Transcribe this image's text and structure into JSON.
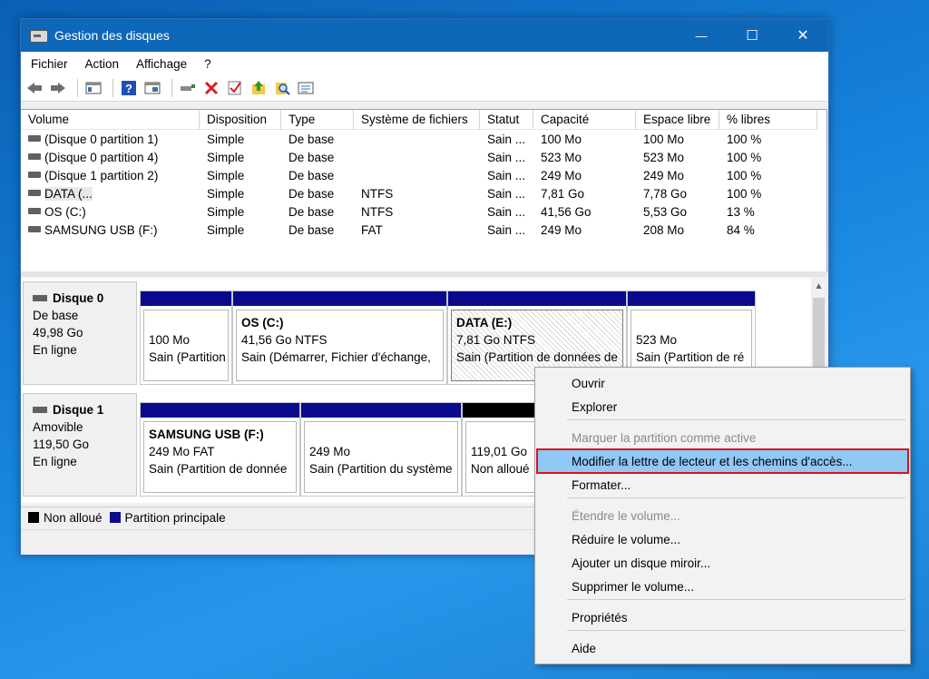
{
  "window": {
    "title": "Gestion des disques",
    "minimize": "—",
    "maximize": "☐",
    "close": "✕"
  },
  "menu": [
    "Fichier",
    "Action",
    "Affichage",
    "?"
  ],
  "toolbar_icons": [
    "back-icon",
    "forward-icon",
    "console-tree-icon",
    "help-icon",
    "view-icon",
    "connect-icon",
    "delete-icon",
    "check-icon",
    "up-icon",
    "search-icon",
    "properties-icon"
  ],
  "volumes": {
    "columns": [
      "Volume",
      "Disposition",
      "Type",
      "Système de fichiers",
      "Statut",
      "Capacité",
      "Espace libre",
      "% libres"
    ],
    "rows": [
      [
        "(Disque 0 partition 1)",
        "Simple",
        "De base",
        "",
        "Sain ...",
        "100 Mo",
        "100 Mo",
        "100 %"
      ],
      [
        "(Disque 0 partition 4)",
        "Simple",
        "De base",
        "",
        "Sain ...",
        "523 Mo",
        "523 Mo",
        "100 %"
      ],
      [
        "(Disque 1 partition 2)",
        "Simple",
        "De base",
        "",
        "Sain ...",
        "249 Mo",
        "249 Mo",
        "100 %"
      ],
      [
        "DATA (...",
        "Simple",
        "De base",
        "NTFS",
        "Sain ...",
        "7,81 Go",
        "7,78 Go",
        "100 %"
      ],
      [
        "OS (C:)",
        "Simple",
        "De base",
        "NTFS",
        "Sain ...",
        "41,56 Go",
        "5,53 Go",
        "13 %"
      ],
      [
        "SAMSUNG USB (F:)",
        "Simple",
        "De base",
        "FAT",
        "Sain ...",
        "249 Mo",
        "208 Mo",
        "84 %"
      ]
    ]
  },
  "disks": [
    {
      "name": "Disque 0",
      "type": "De base",
      "size": "49,98 Go",
      "status": "En ligne",
      "partitions": [
        {
          "name": "",
          "line1": "100 Mo",
          "line2": "Sain (Partition"
        },
        {
          "name": "OS  (C:)",
          "line1": "41,56 Go NTFS",
          "line2": "Sain (Démarrer, Fichier d'échange,"
        },
        {
          "name": "DATA  (E:)",
          "line1": "7,81 Go NTFS",
          "line2": "Sain (Partition de données de"
        },
        {
          "name": "",
          "line1": "523 Mo",
          "line2": "Sain (Partition de ré"
        }
      ]
    },
    {
      "name": "Disque 1",
      "type": "Amovible",
      "size": "119,50 Go",
      "status": "En ligne",
      "partitions": [
        {
          "name": "SAMSUNG USB  (F:)",
          "line1": "249 Mo FAT",
          "line2": "Sain (Partition de donnée"
        },
        {
          "name": "",
          "line1": "249 Mo",
          "line2": "Sain (Partition du système"
        },
        {
          "name": "",
          "line1": "119,01 Go",
          "line2": "Non alloué"
        }
      ]
    }
  ],
  "legend": {
    "unallocated": "Non alloué",
    "primary": "Partition principale",
    "unallocated_color": "#000000",
    "primary_color": "#0a0a8c"
  },
  "context_menu": {
    "items": [
      {
        "label": "Ouvrir"
      },
      {
        "label": "Explorer"
      },
      {
        "label": "Marquer la partition comme active",
        "disabled": true
      },
      {
        "label": "Modifier la lettre de lecteur et les chemins d'accès...",
        "highlight": true
      },
      {
        "label": "Formater..."
      },
      {
        "label": "Étendre le volume...",
        "disabled": true
      },
      {
        "label": "Réduire le volume..."
      },
      {
        "label": "Ajouter un disque miroir..."
      },
      {
        "label": "Supprimer le volume..."
      },
      {
        "label": "Propriétés"
      },
      {
        "label": "Aide"
      }
    ]
  }
}
